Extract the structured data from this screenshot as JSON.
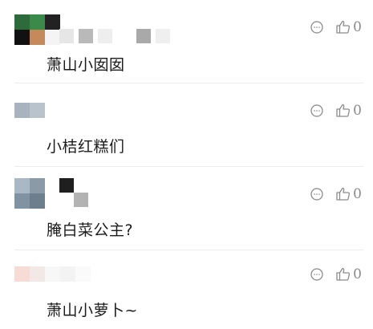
{
  "comments": [
    {
      "text": "萧山小囡囡",
      "likes": "0"
    },
    {
      "text": "小桔红糕们",
      "likes": "0"
    },
    {
      "text": "腌白菜公主?",
      "likes": "0"
    },
    {
      "text": "萧山小萝卜~",
      "likes": "0"
    }
  ],
  "icons": {
    "reply": "reply-bubble-icon",
    "like": "thumbs-up-icon"
  },
  "colors": {
    "icon_gray": "#8a8a8a",
    "text": "#1b1b1b",
    "divider": "#ececec"
  }
}
